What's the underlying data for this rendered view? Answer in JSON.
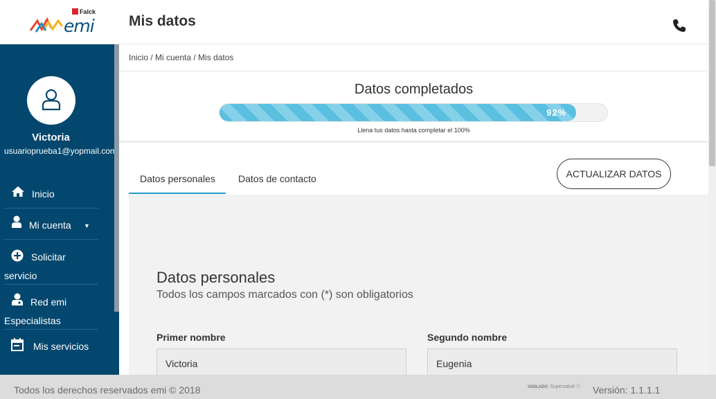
{
  "header": {
    "brand_small": "Falck",
    "brand": "emi",
    "title": "Mis datos",
    "phone_icon": "phone-icon"
  },
  "sidebar": {
    "user_name": "Victoria",
    "user_email": "usuarioprueba1@yopmail.com",
    "items": [
      {
        "label": "Inicio",
        "icon": "home-icon"
      },
      {
        "label": "Mi cuenta",
        "icon": "user-icon"
      },
      {
        "label": "Solicitar servicio",
        "line1": "Solicitar",
        "line2": "servicio",
        "icon": "plus-circle-icon"
      },
      {
        "label": "Red emi Especialistas",
        "line1": "Red emi",
        "line2": "Especialistas",
        "icon": "doctor-icon"
      },
      {
        "label": "Mis servicios",
        "icon": "calendar-icon"
      }
    ]
  },
  "breadcrumb": "Inicio / Mi cuenta / Mis datos",
  "progress": {
    "title": "Datos completados",
    "value": 0.92,
    "value_label": "92%",
    "hint": "Llena tus datos hasta completar el 100%"
  },
  "tabs": [
    {
      "label": "Datos personales",
      "active": true
    },
    {
      "label": "Datos de contacto",
      "active": false
    }
  ],
  "update_button": "ACTUALIZAR DATOS",
  "section": {
    "title": "Datos personales",
    "subtitle": "Todos los campos marcados con (*) son obligatorios"
  },
  "fields": [
    {
      "label": "Primer nombre",
      "value": "Victoria"
    },
    {
      "label": "Segundo nombre",
      "value": "Eugenia"
    }
  ],
  "footer": {
    "copyright": "Todos los derechos reservados emi © 2018",
    "vigilado_prefix": "VIGILADO",
    "vigilado": "Supersalud",
    "version": "Versión: 1.1.1.1"
  },
  "colors": {
    "sidebar_bg": "#03476e",
    "progress_fill": "#5bbfdf",
    "tab_accent": "#1d9bc7",
    "content_bg": "#f2f2f2"
  }
}
